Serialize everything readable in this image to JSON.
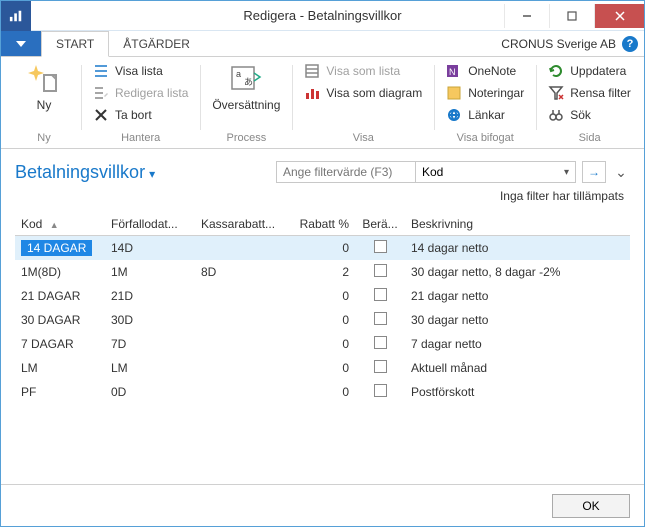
{
  "window": {
    "title": "Redigera - Betalningsvillkor"
  },
  "tabs": {
    "start": "START",
    "actions": "ÅTGÄRDER"
  },
  "company": "CRONUS Sverige AB",
  "ribbon": {
    "ny": {
      "label": "Ny",
      "group": "Ny"
    },
    "hantera": {
      "group": "Hantera",
      "visa_lista": "Visa lista",
      "redigera_lista": "Redigera lista",
      "ta_bort": "Ta bort"
    },
    "process": {
      "group": "Process",
      "oversattning": "Översättning"
    },
    "visa": {
      "group": "Visa",
      "visa_som_lista": "Visa som lista",
      "visa_som_diagram": "Visa som diagram"
    },
    "visa_bifogat": {
      "group": "Visa bifogat",
      "onenote": "OneNote",
      "noteringar": "Noteringar",
      "lankar": "Länkar"
    },
    "sida": {
      "group": "Sida",
      "uppdatera": "Uppdatera",
      "rensa_filter": "Rensa filter",
      "sok": "Sök"
    }
  },
  "page": {
    "title": "Betalningsvillkor"
  },
  "filter": {
    "placeholder": "Ange filtervärde (F3)",
    "field": "Kod",
    "status": "Inga filter har tillämpats"
  },
  "columns": {
    "kod": "Kod",
    "forfallo": "Förfallodat...",
    "kassarabatt": "Kassarabatt...",
    "rabatt": "Rabatt %",
    "berakna": "Berä...",
    "beskrivning": "Beskrivning"
  },
  "rows": [
    {
      "kod": "14 DAGAR",
      "forfallo": "14D",
      "kassarabatt": "",
      "rabatt": "0",
      "beskrivning": "14 dagar netto"
    },
    {
      "kod": "1M(8D)",
      "forfallo": "1M",
      "kassarabatt": "8D",
      "rabatt": "2",
      "beskrivning": "30 dagar netto, 8 dagar -2%"
    },
    {
      "kod": "21 DAGAR",
      "forfallo": "21D",
      "kassarabatt": "",
      "rabatt": "0",
      "beskrivning": "21 dagar netto"
    },
    {
      "kod": "30 DAGAR",
      "forfallo": "30D",
      "kassarabatt": "",
      "rabatt": "0",
      "beskrivning": "30 dagar netto"
    },
    {
      "kod": "7 DAGAR",
      "forfallo": "7D",
      "kassarabatt": "",
      "rabatt": "0",
      "beskrivning": "7 dagar netto"
    },
    {
      "kod": "LM",
      "forfallo": "LM",
      "kassarabatt": "",
      "rabatt": "0",
      "beskrivning": "Aktuell månad"
    },
    {
      "kod": "PF",
      "forfallo": "0D",
      "kassarabatt": "",
      "rabatt": "0",
      "beskrivning": "Postförskott"
    }
  ],
  "footer": {
    "ok": "OK"
  }
}
